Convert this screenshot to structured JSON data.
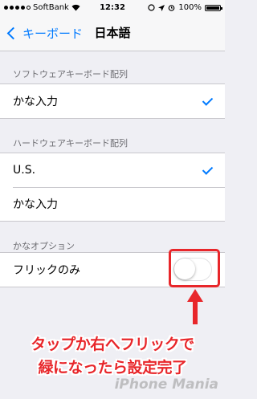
{
  "status_bar": {
    "carrier": "SoftBank",
    "time": "12:32",
    "battery": "100%",
    "battery_level": 1.0
  },
  "nav": {
    "back_label": "キーボード",
    "title": "日本語"
  },
  "sections": [
    {
      "header": "ソフトウェアキーボード配列",
      "rows": [
        {
          "label": "かな入力",
          "checked": true
        }
      ]
    },
    {
      "header": "ハードウェアキーボード配列",
      "rows": [
        {
          "label": "U.S.",
          "checked": true
        },
        {
          "label": "かな入力",
          "checked": false
        }
      ]
    },
    {
      "header": "かなオプション",
      "rows": [
        {
          "label": "フリックのみ",
          "toggle": false
        }
      ]
    }
  ],
  "annotation": {
    "line1": "タップか右へフリックで",
    "line2": "緑になったら設定完了",
    "color": "#e8262a"
  },
  "watermark": "iPhone Mania"
}
